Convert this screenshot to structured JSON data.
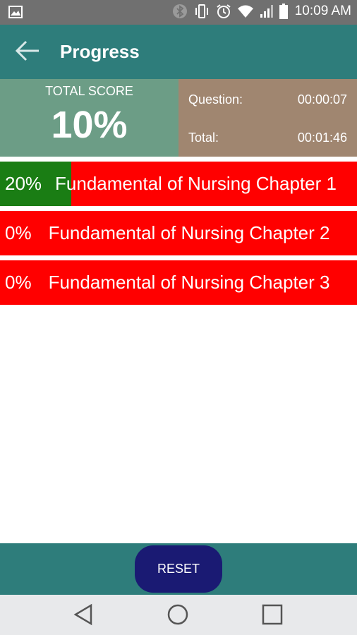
{
  "status_bar": {
    "time": "10:09 AM",
    "icons": [
      "image-icon",
      "bluetooth-icon",
      "vibrate-icon",
      "alarm-icon",
      "wifi-icon",
      "signal-icon",
      "battery-icon"
    ]
  },
  "app_bar": {
    "title": "Progress",
    "back_icon": "arrow-left-icon"
  },
  "score": {
    "label": "TOTAL SCORE",
    "value": "10%"
  },
  "timer": {
    "question_label": "Question:",
    "question_time": "00:00:07",
    "total_label": "Total:",
    "total_time": "00:01:46"
  },
  "chapters": [
    {
      "percent_label": "20%",
      "progress": 0.2,
      "name": "Fundamental of Nursing Chapter 1"
    },
    {
      "percent_label": "0%",
      "progress": 0,
      "name": "Fundamental of Nursing Chapter 2"
    },
    {
      "percent_label": "0%",
      "progress": 0,
      "name": "Fundamental of Nursing Chapter 3"
    }
  ],
  "bottom": {
    "reset_label": "RESET"
  },
  "colors": {
    "app_bar": "#2e7d7b",
    "score_panel": "#6c9d86",
    "time_panel": "#a08670",
    "chapter_bg": "#ff0000",
    "chapter_fill": "#1a7d14",
    "reset_button": "#1a1a73"
  },
  "nav_bar": {
    "icons": [
      "back-triangle-icon",
      "home-circle-icon",
      "recents-square-icon"
    ]
  }
}
